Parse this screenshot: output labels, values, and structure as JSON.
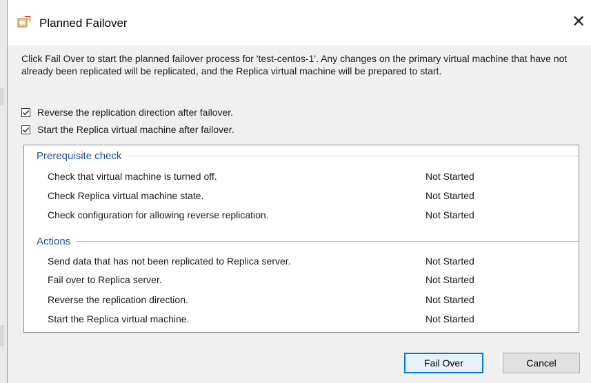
{
  "dialog": {
    "title": "Planned Failover",
    "close_symbol": "✕",
    "description": "Click Fail Over to start the planned failover process for 'test-centos-1'. Any changes on the primary virtual machine that have not already been replicated will be replicated, and the Replica virtual machine will be prepared to start."
  },
  "options": [
    {
      "label": "Reverse the replication direction after failover.",
      "checked": true
    },
    {
      "label": "Start the Replica virtual machine after failover.",
      "checked": true
    }
  ],
  "prerequisite": {
    "title": "Prerequisite check",
    "items": [
      {
        "label": "Check that virtual machine is turned off.",
        "status": "Not Started"
      },
      {
        "label": "Check Replica virtual machine state.",
        "status": "Not Started"
      },
      {
        "label": "Check configuration for allowing reverse replication.",
        "status": "Not Started"
      }
    ]
  },
  "actions": {
    "title": "Actions",
    "items": [
      {
        "label": "Send data that has not been replicated to Replica server.",
        "status": "Not Started"
      },
      {
        "label": "Fail over to Replica server.",
        "status": "Not Started"
      },
      {
        "label": "Reverse the replication direction.",
        "status": "Not Started"
      },
      {
        "label": "Start the Replica virtual machine.",
        "status": "Not Started"
      }
    ]
  },
  "buttons": {
    "fail_over": "Fail Over",
    "cancel": "Cancel"
  },
  "icons": {
    "app": "failover-icon",
    "close": "close-icon",
    "check": "checkmark-icon"
  },
  "colors": {
    "group_title": "#1e4fa3",
    "primary_border": "#0078d7",
    "dialog_bg": "#f0f0f0"
  }
}
